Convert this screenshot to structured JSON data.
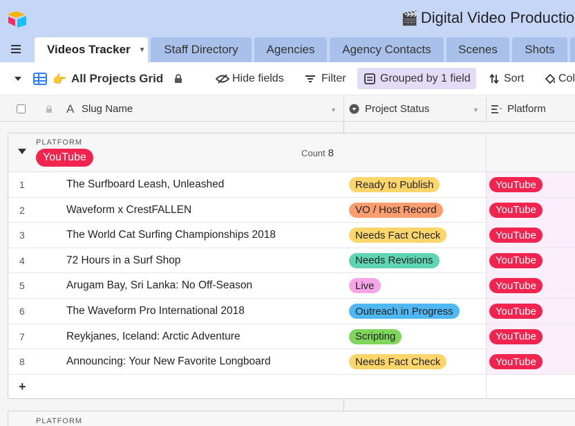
{
  "header": {
    "title": "Digital Video Productio",
    "title_emoji": "🎬"
  },
  "tabs": [
    {
      "label": "Videos Tracker",
      "active": true
    },
    {
      "label": "Staff Directory"
    },
    {
      "label": "Agencies"
    },
    {
      "label": "Agency Contacts"
    },
    {
      "label": "Scenes"
    },
    {
      "label": "Shots"
    }
  ],
  "toolbar": {
    "view_emoji": "👉",
    "view_name": "All Projects Grid",
    "hide_fields": "Hide fields",
    "filter": "Filter",
    "grouped": "Grouped by 1 field",
    "sort": "Sort",
    "color": "Col"
  },
  "columns": {
    "primary": "Slug Name",
    "status": "Project Status",
    "platform": "Platform"
  },
  "group": {
    "field_label": "PLATFORM",
    "value": "YouTube",
    "count_label": "Count",
    "count": "8"
  },
  "rows": [
    {
      "num": "1",
      "title": "The Surfboard Leash, Unleashed",
      "status": "Ready to Publish",
      "platform": "YouTube"
    },
    {
      "num": "2",
      "title": "Waveform x CrestFALLEN",
      "status": "VO / Host Record",
      "platform": "YouTube"
    },
    {
      "num": "3",
      "title": "The World Cat Surfing Championships 2018",
      "status": "Needs Fact Check",
      "platform": "YouTube"
    },
    {
      "num": "4",
      "title": "72 Hours in a Surf Shop",
      "status": "Needs Revisions",
      "platform": "YouTube"
    },
    {
      "num": "5",
      "title": "Arugam Bay, Sri Lanka: No Off-Season",
      "status": "Live",
      "platform": "YouTube"
    },
    {
      "num": "6",
      "title": "The Waveform Pro International 2018",
      "status": "Outreach in Progress",
      "platform": "YouTube"
    },
    {
      "num": "7",
      "title": "Reykjanes, Iceland: Arctic Adventure",
      "status": "Scripting",
      "platform": "YouTube"
    },
    {
      "num": "8",
      "title": "Announcing: Your New Favorite Longboard",
      "status": "Needs Fact Check",
      "platform": "YouTube"
    }
  ],
  "status_colors": {
    "Ready to Publish": "#fcd56b",
    "VO / Host Record": "#fb9d6f",
    "Needs Fact Check": "#fcd56b",
    "Needs Revisions": "#5ed6b4",
    "Live": "#f6a6e6",
    "Outreach in Progress": "#4fb8f2",
    "Scripting": "#7fd65a"
  },
  "add_row_label": "+",
  "next_group_label": "PLATFORM",
  "colors": {
    "header_bg": "#c5d6f7",
    "platform_chip": "#f0244e",
    "grouped_pill": "#e3dcf6"
  }
}
